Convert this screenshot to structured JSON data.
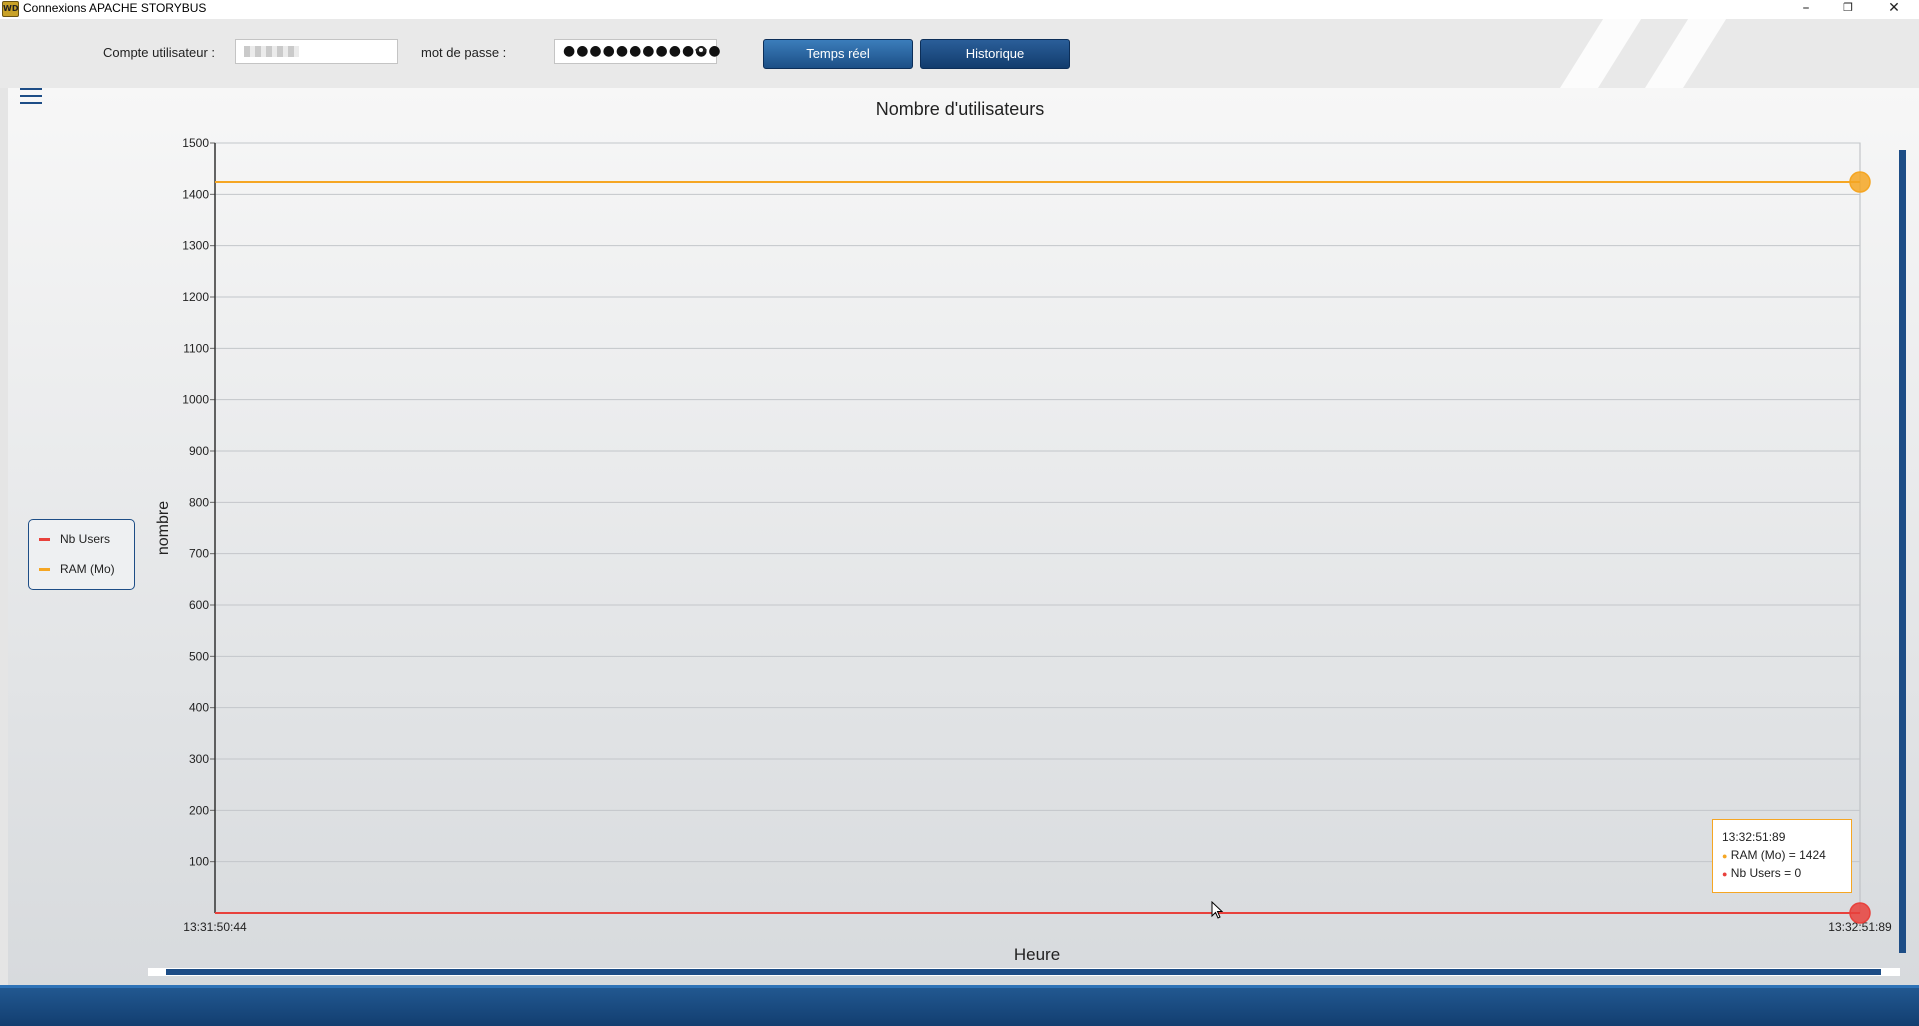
{
  "window": {
    "title": "Connexions APACHE STORYBUS",
    "icon": "WD",
    "controls": {
      "minimize": "–",
      "restore": "❐",
      "close": "✕"
    }
  },
  "toolbar": {
    "account_label": "Compte utilisateur :",
    "password_label": "mot de passe :",
    "password_value": "●●●●●●●●●●●●",
    "eye_icon": "eye-icon",
    "realtime_button": "Temps réel",
    "history_button": "Historique"
  },
  "legend": {
    "items": [
      {
        "label": "Nb Users",
        "color": "#e8413c"
      },
      {
        "label": "RAM (Mo)",
        "color": "#f5a623"
      }
    ]
  },
  "tooltip": {
    "time": "13:32:51:89",
    "lines": [
      "RAM (Mo) = 1424",
      "Nb Users = 0"
    ]
  },
  "chart_data": {
    "type": "line",
    "title": "Nombre d'utilisateurs",
    "xlabel": "Heure",
    "ylabel": "nombre",
    "ylim": [
      0,
      1500
    ],
    "yticks": [
      100,
      200,
      300,
      400,
      500,
      600,
      700,
      800,
      900,
      1000,
      1100,
      1200,
      1300,
      1400,
      1500
    ],
    "x": [
      "13:31:50:44",
      "13:32:51:89"
    ],
    "series": [
      {
        "name": "RAM (Mo)",
        "color": "#f5a623",
        "values": [
          1424,
          1424
        ]
      },
      {
        "name": "Nb Users",
        "color": "#e8413c",
        "values": [
          0,
          0
        ]
      }
    ],
    "grid": true,
    "legend_position": "left"
  }
}
